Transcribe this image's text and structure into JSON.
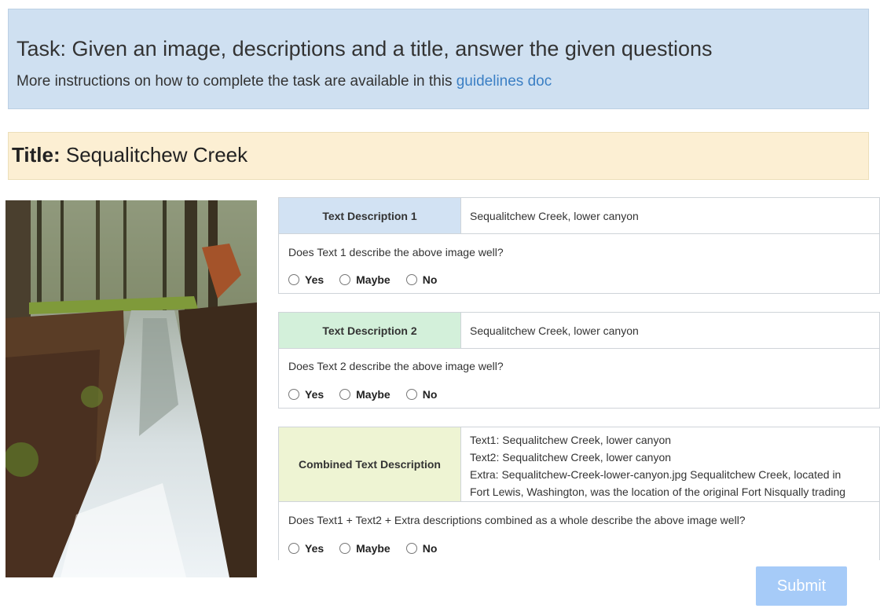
{
  "task": {
    "heading": "Task: Given an image, descriptions and a title, answer the given questions",
    "instructions_prefix": "More instructions on how to complete the task are available in this",
    "guidelines_link": "guidelines doc"
  },
  "title": {
    "label": "Title:",
    "value": "Sequalitchew Creek"
  },
  "block1": {
    "header": "Text Description 1",
    "description": "Sequalitchew Creek, lower canyon",
    "question": "Does Text 1 describe the above image well?",
    "header_color": "#d2e2f3"
  },
  "block2": {
    "header": "Text Description 2",
    "description": "Sequalitchew Creek, lower canyon",
    "question": "Does Text 2 describe the above image well?",
    "header_color": "#d3f0da"
  },
  "block3": {
    "header": "Combined Text Description",
    "lines": [
      "Text1: Sequalitchew Creek, lower canyon",
      "Text2: Sequalitchew Creek, lower canyon",
      "Extra: Sequalitchew-Creek-lower-canyon.jpg Sequalitchew Creek, located in",
      "Fort Lewis, Washington, was the location of the original Fort Nisqually trading"
    ],
    "question": "Does Text1 + Text2 + Extra descriptions combined as a whole describe the above image well?",
    "header_color": "#eef4d3"
  },
  "options": {
    "yes": "Yes",
    "maybe": "Maybe",
    "no": "No"
  },
  "submit_label": "Submit",
  "colors": {
    "task_bg": "#cfe0f1",
    "title_bg": "#fcefd3",
    "link": "#3b7fc4",
    "submit_bg": "#a6cbf8"
  }
}
